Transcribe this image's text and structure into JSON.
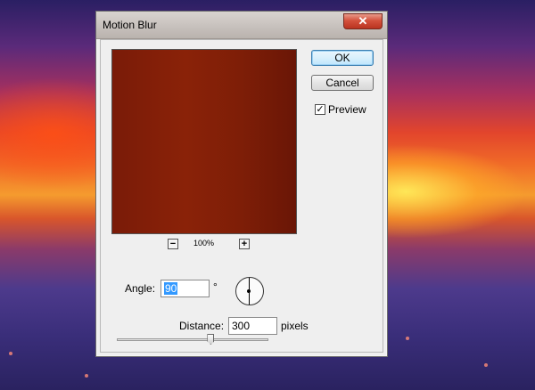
{
  "dialog": {
    "title": "Motion Blur",
    "close_symbol": "✕"
  },
  "preview": {
    "zoom_out_symbol": "−",
    "zoom_in_symbol": "+",
    "zoom_level": "100%",
    "fill_color": "#7c1c07"
  },
  "buttons": {
    "ok": "OK",
    "cancel": "Cancel"
  },
  "options": {
    "preview_label": "Preview",
    "preview_checked": true,
    "check_symbol": "✓"
  },
  "angle": {
    "label": "Angle:",
    "value": "90",
    "unit": "°"
  },
  "distance": {
    "label": "Distance:",
    "value": "300",
    "unit": "pixels",
    "slider_fraction": 0.62
  }
}
